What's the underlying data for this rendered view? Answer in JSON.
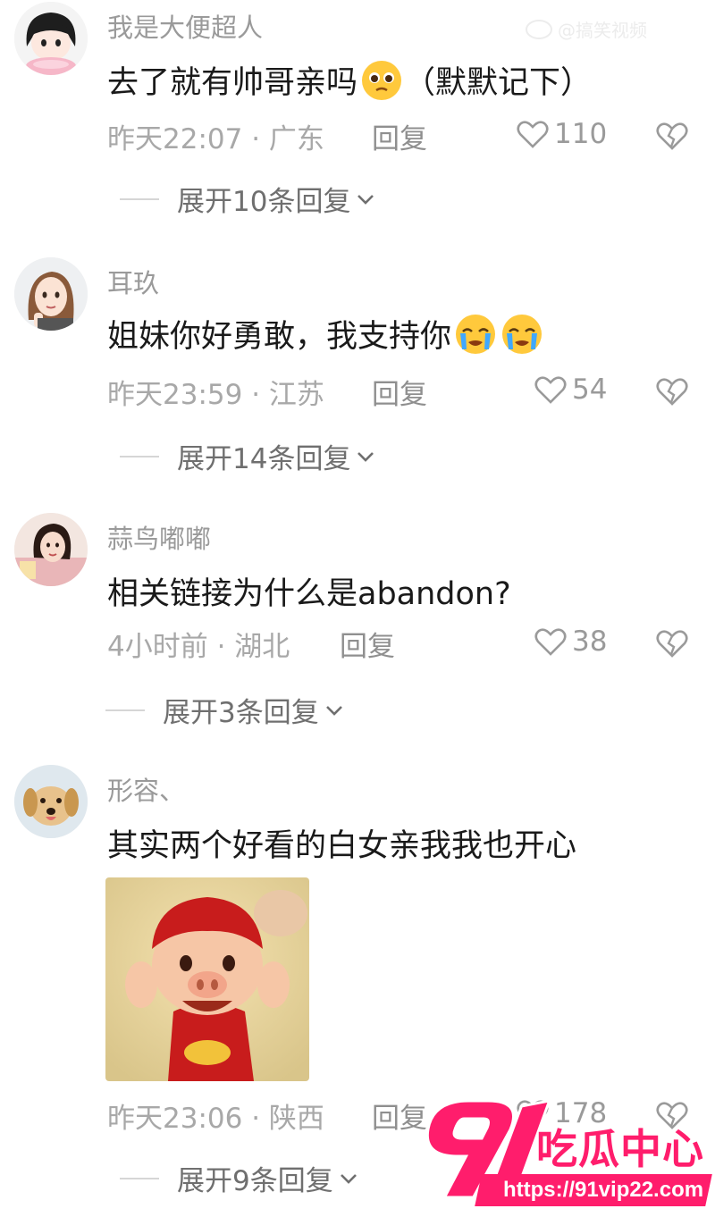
{
  "watermark": {
    "text": "@搞笑视频"
  },
  "comments": [
    {
      "username": "我是大便超人",
      "text_before": "去了就有帅哥亲吗",
      "text_after": " （默默记下）",
      "time": "昨天22:07 · 广东",
      "reply_label": "回复",
      "likes": "110",
      "expand": "展开10条回复",
      "emoji": [
        "pleading-face"
      ]
    },
    {
      "username": "耳玖",
      "text_before": "姐妹你好勇敢，我支持你",
      "text_after": "",
      "time": "昨天23:59 · 江苏",
      "reply_label": "回复",
      "likes": "54",
      "expand": "展开14条回复",
      "emoji": [
        "crying-face",
        "crying-face"
      ]
    },
    {
      "username": "蒜鸟嘟嘟",
      "text_before": "相关链接为什么是abandon?",
      "text_after": "",
      "time": "4小时前 · 湖北",
      "reply_label": "回复",
      "likes": "38",
      "expand": "展开3条回复",
      "emoji": []
    },
    {
      "username": "形容、",
      "text_before": "其实两个好看的白女亲我我也开心",
      "text_after": "",
      "time": "昨天23:06 · 陕西",
      "reply_label": "回复",
      "likes": "178",
      "expand": "展开9条回复",
      "emoji": [],
      "attachment": "cartoon-pig-sticker"
    }
  ],
  "brand": {
    "number": "91",
    "name": "吃瓜中心",
    "url": "https://91vip22.com",
    "color": "#ff1d6c"
  }
}
